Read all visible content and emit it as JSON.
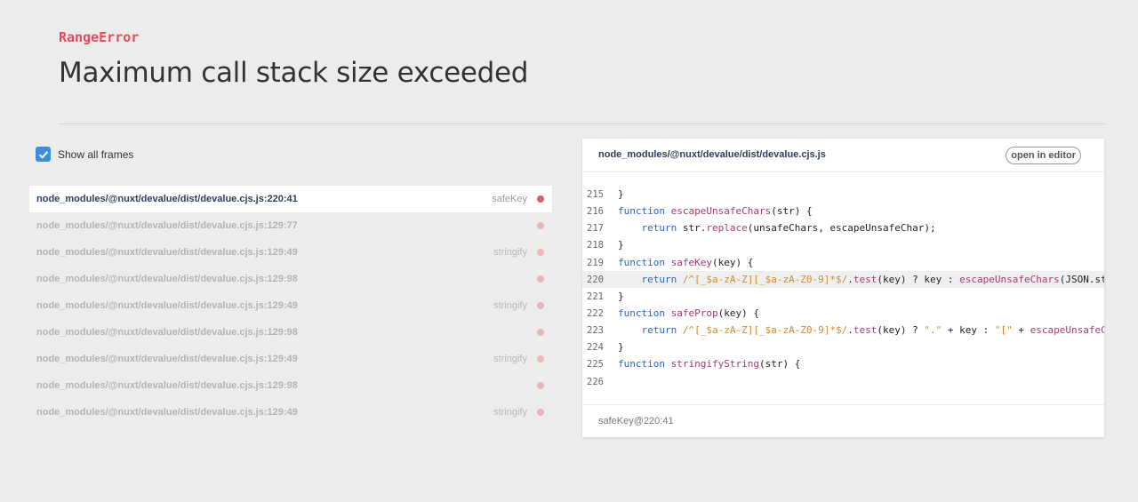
{
  "error": {
    "name": "RangeError",
    "message": "Maximum call stack size exceeded"
  },
  "options": {
    "show_all_frames_label": "Show all frames",
    "show_all_frames_checked": true
  },
  "frames": [
    {
      "path": "node_modules/@nuxt/devalue/dist/devalue.cjs.js:220:41",
      "fn": "safeKey",
      "active": true
    },
    {
      "path": "node_modules/@nuxt/devalue/dist/devalue.cjs.js:129:77",
      "fn": "",
      "active": false
    },
    {
      "path": "node_modules/@nuxt/devalue/dist/devalue.cjs.js:129:49",
      "fn": "stringify",
      "active": false
    },
    {
      "path": "node_modules/@nuxt/devalue/dist/devalue.cjs.js:129:98",
      "fn": "",
      "active": false
    },
    {
      "path": "node_modules/@nuxt/devalue/dist/devalue.cjs.js:129:49",
      "fn": "stringify",
      "active": false
    },
    {
      "path": "node_modules/@nuxt/devalue/dist/devalue.cjs.js:129:98",
      "fn": "",
      "active": false
    },
    {
      "path": "node_modules/@nuxt/devalue/dist/devalue.cjs.js:129:49",
      "fn": "stringify",
      "active": false
    },
    {
      "path": "node_modules/@nuxt/devalue/dist/devalue.cjs.js:129:98",
      "fn": "",
      "active": false
    },
    {
      "path": "node_modules/@nuxt/devalue/dist/devalue.cjs.js:129:49",
      "fn": "stringify",
      "active": false
    }
  ],
  "code_panel": {
    "file": "node_modules/@nuxt/devalue/dist/devalue.cjs.js",
    "open_in_editor_label": "open in editor",
    "footer": "safeKey@220:41",
    "highlighted_line": 220,
    "lines": [
      {
        "n": "215",
        "tokens": [
          [
            "p",
            "}"
          ]
        ]
      },
      {
        "n": "216",
        "tokens": [
          [
            "k",
            "function "
          ],
          [
            "f",
            "escapeUnsafeChars"
          ],
          [
            "p",
            "(str) {"
          ]
        ]
      },
      {
        "n": "217",
        "tokens": [
          [
            "p",
            "    "
          ],
          [
            "k",
            "return "
          ],
          [
            "p",
            "str."
          ],
          [
            "f",
            "replace"
          ],
          [
            "p",
            "(unsafeChars, escapeUnsafeChar);"
          ]
        ]
      },
      {
        "n": "218",
        "tokens": [
          [
            "p",
            "}"
          ]
        ]
      },
      {
        "n": "219",
        "tokens": [
          [
            "k",
            "function "
          ],
          [
            "f",
            "safeKey"
          ],
          [
            "p",
            "(key) {"
          ]
        ]
      },
      {
        "n": "220",
        "tokens": [
          [
            "p",
            "    "
          ],
          [
            "k",
            "return "
          ],
          [
            "s",
            "/^[_$a-zA-Z][_$a-zA-Z0-9]*$/"
          ],
          [
            "p",
            "."
          ],
          [
            "f",
            "test"
          ],
          [
            "p",
            "(key) ? key : "
          ],
          [
            "f",
            "escapeUnsafeChars"
          ],
          [
            "p",
            "(JSON.str"
          ]
        ]
      },
      {
        "n": "221",
        "tokens": [
          [
            "p",
            "}"
          ]
        ]
      },
      {
        "n": "222",
        "tokens": [
          [
            "k",
            "function "
          ],
          [
            "f",
            "safeProp"
          ],
          [
            "p",
            "(key) {"
          ]
        ]
      },
      {
        "n": "223",
        "tokens": [
          [
            "p",
            "    "
          ],
          [
            "k",
            "return "
          ],
          [
            "s",
            "/^[_$a-zA-Z][_$a-zA-Z0-9]*$/"
          ],
          [
            "p",
            "."
          ],
          [
            "f",
            "test"
          ],
          [
            "p",
            "(key) ? "
          ],
          [
            "s",
            "\".\""
          ],
          [
            "p",
            " + key : "
          ],
          [
            "s",
            "\"[\""
          ],
          [
            "p",
            " + "
          ],
          [
            "f",
            "escapeUnsafeCha"
          ]
        ]
      },
      {
        "n": "224",
        "tokens": [
          [
            "p",
            "}"
          ]
        ]
      },
      {
        "n": "225",
        "tokens": [
          [
            "k",
            "function "
          ],
          [
            "f",
            "stringifyString"
          ],
          [
            "p",
            "(str) {"
          ]
        ]
      },
      {
        "n": "226",
        "tokens": []
      }
    ]
  },
  "colors": {
    "error_accent": "#e24c5c",
    "checkbox_blue": "#3d8fd9",
    "keyword": "#2f63c7",
    "function": "#a23c73",
    "string": "#d18a2c"
  }
}
